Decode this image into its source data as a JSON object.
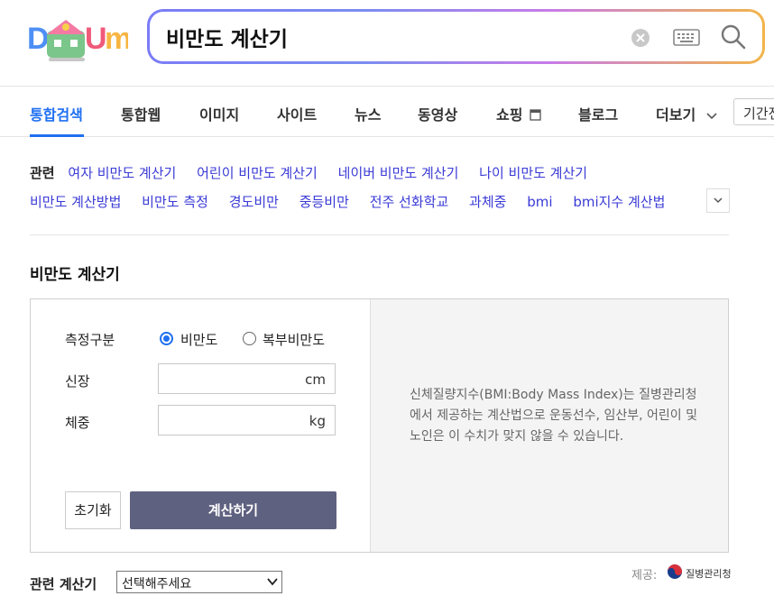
{
  "header": {
    "logo_text": "DAUM",
    "search": {
      "value": "비만도 계산기"
    }
  },
  "tabs": [
    {
      "label": "통합검색",
      "active": true
    },
    {
      "label": "통합웹"
    },
    {
      "label": "이미지"
    },
    {
      "label": "사이트"
    },
    {
      "label": "뉴스"
    },
    {
      "label": "동영상"
    },
    {
      "label": "쇼핑"
    },
    {
      "label": "블로그"
    },
    {
      "label": "더보기"
    }
  ],
  "period_label": "기간전",
  "related": {
    "title": "관련",
    "row1": [
      "여자 비만도 계산기",
      "어린이 비만도 계산기",
      "네이버 비만도 계산기",
      "나이 비만도 계산기"
    ],
    "row2": [
      "비만도 계산방법",
      "비만도 측정",
      "경도비만",
      "중등비만",
      "전주 선화학교",
      "과체중",
      "bmi",
      "bmi지수 계산법"
    ]
  },
  "calculator": {
    "title": "비만도 계산기",
    "measure_label": "측정구분",
    "options": [
      {
        "label": "비만도",
        "checked": true
      },
      {
        "label": "복부비만도",
        "checked": false
      }
    ],
    "height_label": "신장",
    "height_unit": "cm",
    "weight_label": "체중",
    "weight_unit": "kg",
    "reset_label": "초기화",
    "calc_label": "계산하기",
    "description": "신체질량지수(BMI:Body Mass Index)는 질병관리청에서 제공하는 계산법으로 운동선수, 임산부, 어린이 및 노인은 이 수치가 맞지 않을 수 있습니다."
  },
  "provider": {
    "label": "제공:",
    "name": "질병관리청"
  },
  "related_calc": {
    "label": "관련 계산기",
    "select_value": "선택해주세요"
  },
  "colors": {
    "accent": "#1f6ff1",
    "calc_button": "#5f6180",
    "link": "#3a3ad6"
  }
}
